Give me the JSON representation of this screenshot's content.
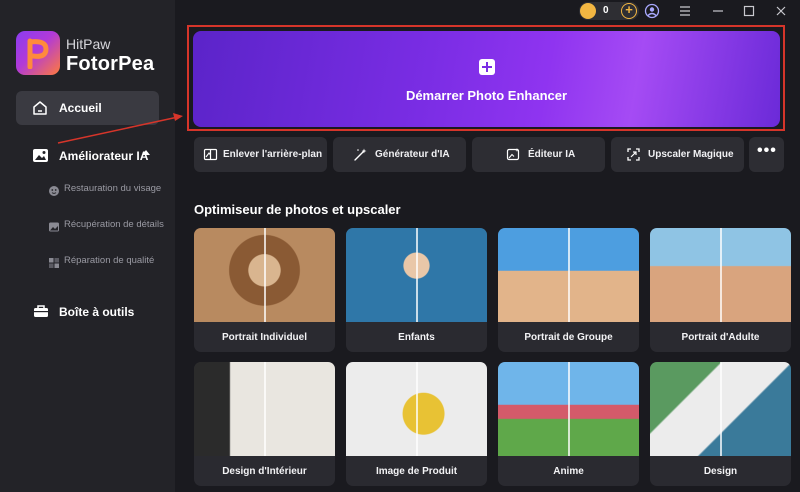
{
  "app": {
    "brand_small": "HitPaw",
    "brand_big": "FotorPea"
  },
  "topbar": {
    "coin_count": "0"
  },
  "sidebar": {
    "home": "Accueil",
    "enhancer": "Améliorateur IA",
    "sub_items": [
      {
        "label": "Restauration du visage"
      },
      {
        "label": "Récupération de détails"
      },
      {
        "label": "Réparation de qualité"
      }
    ],
    "toolbox": "Boîte à outils"
  },
  "hero": {
    "label": "Démarrer Photo Enhancer"
  },
  "tools": [
    {
      "label": "Enlever l'arrière-plan"
    },
    {
      "label": "Générateur d'IA"
    },
    {
      "label": "Éditeur IA"
    },
    {
      "label": "Upscaler Magique"
    }
  ],
  "section": {
    "title": "Optimiseur de photos et upscaler"
  },
  "cards": [
    {
      "label": "Portrait Individuel"
    },
    {
      "label": "Enfants"
    },
    {
      "label": "Portrait de Groupe"
    },
    {
      "label": "Portrait d'Adulte"
    },
    {
      "label": "Design d'Intérieur"
    },
    {
      "label": "Image de Produit"
    },
    {
      "label": "Anime"
    },
    {
      "label": "Design"
    }
  ],
  "colors": {
    "accent": "#7a2de4",
    "annotation": "#d6352a",
    "coin": "#f2b642"
  }
}
